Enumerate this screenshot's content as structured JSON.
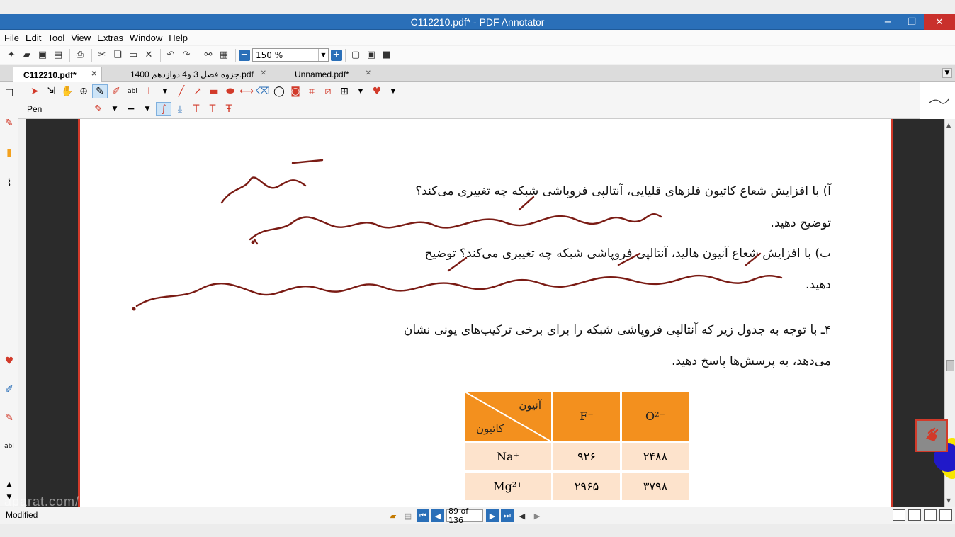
{
  "window": {
    "title": "C112210.pdf* - PDF Annotator",
    "minimize": "−",
    "maximize": "❐",
    "close": "✕"
  },
  "menu": [
    "File",
    "Edit",
    "Tool",
    "View",
    "Extras",
    "Window",
    "Help"
  ],
  "toolbar": {
    "zoom_value": "150 %"
  },
  "tabs": [
    {
      "label": "C112210.pdf*",
      "active": true
    },
    {
      "label": "جزوه فصل 3 و4 دوازدهم 1400.pdf",
      "active": false
    },
    {
      "label": "Unnamed.pdf*",
      "active": false
    }
  ],
  "pen_toolbar": {
    "tool_name": "Pen"
  },
  "document": {
    "q_a": "آ) با افزایش شعاع کاتیون فلزهای قلیایی، آنتالپی فروپاشی شبکه چه تغییری می‌کند؟",
    "q_a2": "توضیح دهید.",
    "q_b": "ب) با افزایش شعاع آنیون هالید، آنتالپی فروپاشی شبکه چه تغییری می‌کند؟ توضیح",
    "q_b2": "دهید.",
    "q_4": "۴ـ با توجه به جدول زیر که آنتالپی فروپاشی شبکه را برای برخی ترکیب‌های یونی نشان",
    "q_4b": "می‌دهد، به پرسش‌ها پاسخ دهید.",
    "table": {
      "corner_top": "آنیون",
      "corner_bottom": "کاتیون",
      "col1": "F⁻",
      "col2": "O²⁻",
      "rows": [
        {
          "cation": "Na⁺",
          "v1": "۹۲۶",
          "v2": "۲۴۸۸"
        },
        {
          "cation": "Mg²⁺",
          "v1": "۲۹۶۵",
          "v2": "۳۷۹۸"
        }
      ]
    }
  },
  "status": {
    "text": "Modified",
    "page_indicator": "89 of 136",
    "watermark": "aparat.com/..."
  },
  "colors": {
    "titlebar": "#2a6fb8",
    "ink": "#7a1b14",
    "table_header": "#f3901e",
    "table_cell": "#fde3cc",
    "page_border": "#d23a2a"
  }
}
